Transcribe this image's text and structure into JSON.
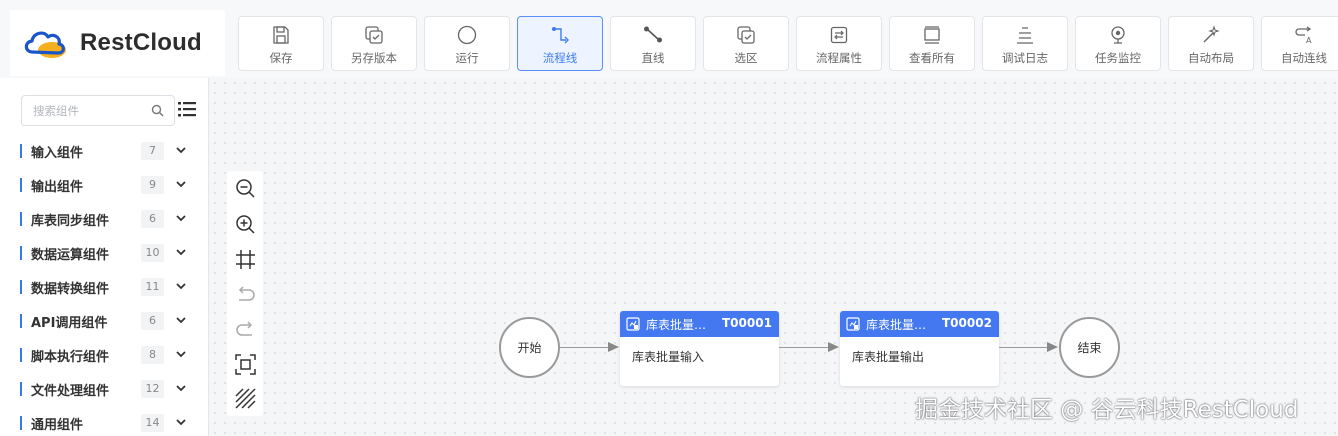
{
  "app": {
    "brand": "RestCloud"
  },
  "toolbar": [
    {
      "label": "保存",
      "icon": "save-icon"
    },
    {
      "label": "另存版本",
      "icon": "save-version-icon"
    },
    {
      "label": "运行",
      "icon": "run-icon"
    },
    {
      "label": "流程线",
      "icon": "flow-line-icon",
      "active": true
    },
    {
      "label": "直线",
      "icon": "straight-line-icon"
    },
    {
      "label": "选区",
      "icon": "select-area-icon"
    },
    {
      "label": "流程属性",
      "icon": "flow-properties-icon"
    },
    {
      "label": "查看所有",
      "icon": "view-all-icon"
    },
    {
      "label": "调试日志",
      "icon": "debug-log-icon"
    },
    {
      "label": "任务监控",
      "icon": "task-monitor-icon"
    },
    {
      "label": "自动布局",
      "icon": "auto-layout-icon"
    },
    {
      "label": "自动连线",
      "icon": "auto-connect-icon"
    }
  ],
  "sidebar": {
    "search": {
      "placeholder": "搜索组件",
      "value": ""
    },
    "groups": [
      {
        "name": "输入组件",
        "count": "7"
      },
      {
        "name": "输出组件",
        "count": "9"
      },
      {
        "name": "库表同步组件",
        "count": "6"
      },
      {
        "name": "数据运算组件",
        "count": "10"
      },
      {
        "name": "数据转换组件",
        "count": "11"
      },
      {
        "name": "API调用组件",
        "count": "6"
      },
      {
        "name": "脚本执行组件",
        "count": "8"
      },
      {
        "name": "文件处理组件",
        "count": "12"
      },
      {
        "name": "通用组件",
        "count": "14"
      }
    ]
  },
  "canvas_tools": [
    "zoom-out-icon",
    "zoom-in-icon",
    "fit-view-icon",
    "undo-icon",
    "redo-icon",
    "actual-size-icon",
    "grid-toggle-icon"
  ],
  "flow": {
    "start": {
      "label": "开始"
    },
    "end": {
      "label": "结束"
    },
    "tasks": [
      {
        "title": "库表批量…",
        "id": "T00001",
        "body": "库表批量输入"
      },
      {
        "title": "库表批量…",
        "id": "T00002",
        "body": "库表批量输出"
      }
    ]
  },
  "watermark": "掘金技术社区 @ 谷云科技RestCloud",
  "colors": {
    "accent": "#4478f0",
    "active_border": "#5b8ff9",
    "group_bar": "#3b78e7"
  }
}
